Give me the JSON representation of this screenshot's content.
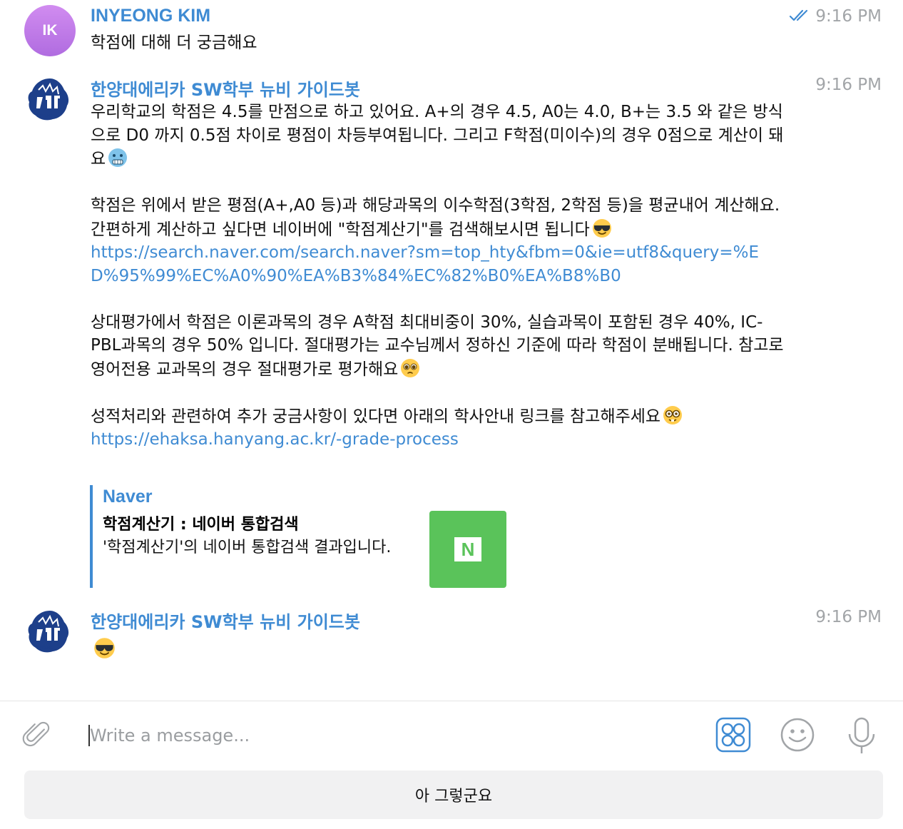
{
  "messages": [
    {
      "sender": "INYEONG KIM",
      "avatar_initials": "IK",
      "time": "9:16 PM",
      "status": "read",
      "text": "학점에 대해 더 궁금해요"
    },
    {
      "sender": "한양대에리카 SW학부 뉴비 가이드봇",
      "time": "9:16 PM",
      "p1": "우리학교의 학점은 4.5를 만점으로 하고 있어요. A+의 경우 4.5, A0는 4.0, B+는 3.5 와 같은 방식으로 D0 까지 0.5점 차이로 평점이 차등부여됩니다. 그리고 F학점(미이수)의 경우 0점으로 계산이 돼요",
      "p2": "학점은 위에서 받은 평점(A+,A0 등)과 해당과목의 이수학점(3학점, 2학점 등)을 평균내어 계산해요. 간편하게 계산하고 싶다면 네이버에 \"학점계산기\"를 검색해보시면 됩니다",
      "link1": "https://search.naver.com/search.naver?sm=top_hty&fbm=0&ie=utf8&query=%ED%95%99%EC%A0%90%EA%B3%84%EC%82%B0%EA%B8%B0",
      "p3": "상대평가에서 학점은 이론과목의 경우 A학점 최대비중이 30%, 실습과목이 포함된 경우 40%, IC-PBL과목의 경우 50% 입니다. 절대평가는 교수님께서 정하신 기준에 따라 학점이 분배됩니다. 참고로 영어전용 교과목의 경우 절대평가로 평가해요",
      "p4": "성적처리와 관련하여 추가 궁금사항이 있다면 아래의 학사안내 링크를 참고해주세요",
      "link2": "https://ehaksa.hanyang.ac.kr/-grade-process",
      "preview": {
        "site": "Naver",
        "title": "학점계산기 : 네이버 통합검색",
        "description": "'학점계산기'의 네이버 통합검색 결과입니다.",
        "thumb_letter": "N"
      }
    },
    {
      "sender": "한양대에리카 SW학부 뉴비 가이드봇",
      "time": "9:16 PM",
      "text": ""
    }
  ],
  "composer": {
    "placeholder": "Write a message..."
  },
  "quick_reply": "아 그렇군요",
  "icons": [
    "paperclip-icon",
    "bot-commands-icon",
    "emoji-icon",
    "microphone-icon",
    "read-double-check-icon"
  ],
  "colors": {
    "accent": "#3f8bd3",
    "time": "#a2a5a8",
    "naver_green": "#5ac35a",
    "avatar_purple": "#c17ee9"
  }
}
